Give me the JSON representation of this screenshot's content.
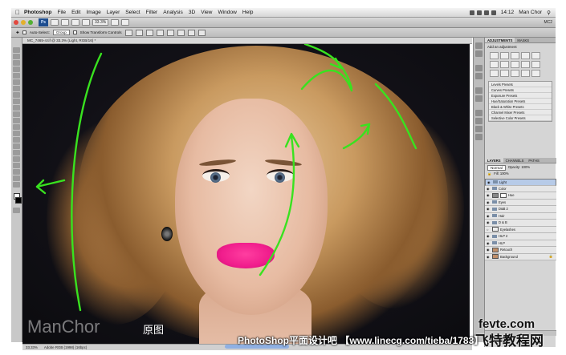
{
  "menubar": {
    "app": "Photoshop",
    "items": [
      "File",
      "Edit",
      "Image",
      "Layer",
      "Select",
      "Filter",
      "Analysis",
      "3D",
      "View",
      "Window",
      "Help"
    ],
    "clock": "14:12",
    "user": "Man Chor"
  },
  "appbar": {
    "logo": "Ps",
    "zoom": "33.3%",
    "workspace": "MC2"
  },
  "options": {
    "auto_select_label": "Auto-Select:",
    "auto_select_value": "Group",
    "transform_label": "Show Transform Controls"
  },
  "document": {
    "tab": "MC_7465-4.tif @ 33.3% (Light, RGB/16) *",
    "zoom": "33.33%",
    "profile": "Adobe RGB (1998) (16bpc)"
  },
  "image": {
    "brand": "ManChor",
    "label": "原图"
  },
  "adjustments": {
    "tabs": [
      "ADJUSTMENTS",
      "MASKS"
    ],
    "title": "Add an adjustment",
    "presets": [
      "Levels Presets",
      "Curves Presets",
      "Exposure Presets",
      "Hue/Saturation Presets",
      "Black & White Presets",
      "Channel Mixer Presets",
      "Selective Color Presets"
    ]
  },
  "layers": {
    "tabs": [
      "LAYERS",
      "CHANNELS",
      "PATHS"
    ],
    "mode": "Normal",
    "opacity": "Opacity: 100%",
    "fill": "Fill: 100%",
    "rows": [
      {
        "name": "Light",
        "kind": "folder",
        "selected": true
      },
      {
        "name": "Color",
        "kind": "folder",
        "selected": false
      },
      {
        "name": "Hue",
        "kind": "adjust",
        "selected": false
      },
      {
        "name": "Eyes",
        "kind": "folder",
        "selected": false
      },
      {
        "name": "D&B 2",
        "kind": "folder",
        "selected": false
      },
      {
        "name": "Hair",
        "kind": "folder",
        "selected": false
      },
      {
        "name": "D & B",
        "kind": "folder",
        "selected": false
      },
      {
        "name": "Eyelashes",
        "kind": "layer",
        "selected": false
      },
      {
        "name": "HLP 2",
        "kind": "folder",
        "selected": false
      },
      {
        "name": "HLP",
        "kind": "folder",
        "selected": false
      },
      {
        "name": "Retouch",
        "kind": "layer",
        "selected": false
      },
      {
        "name": "Background",
        "kind": "layer",
        "selected": false
      }
    ]
  },
  "watermarks": {
    "bottom": "PhotoShop平面设计吧 【www.linecg.com/tieba/1783】",
    "site": "fevte.com",
    "site_cn": "飞特教程网"
  },
  "colors": {
    "arrow": "#39e21f",
    "lips": "#f01d8c",
    "selection": "#b7cbe8"
  }
}
